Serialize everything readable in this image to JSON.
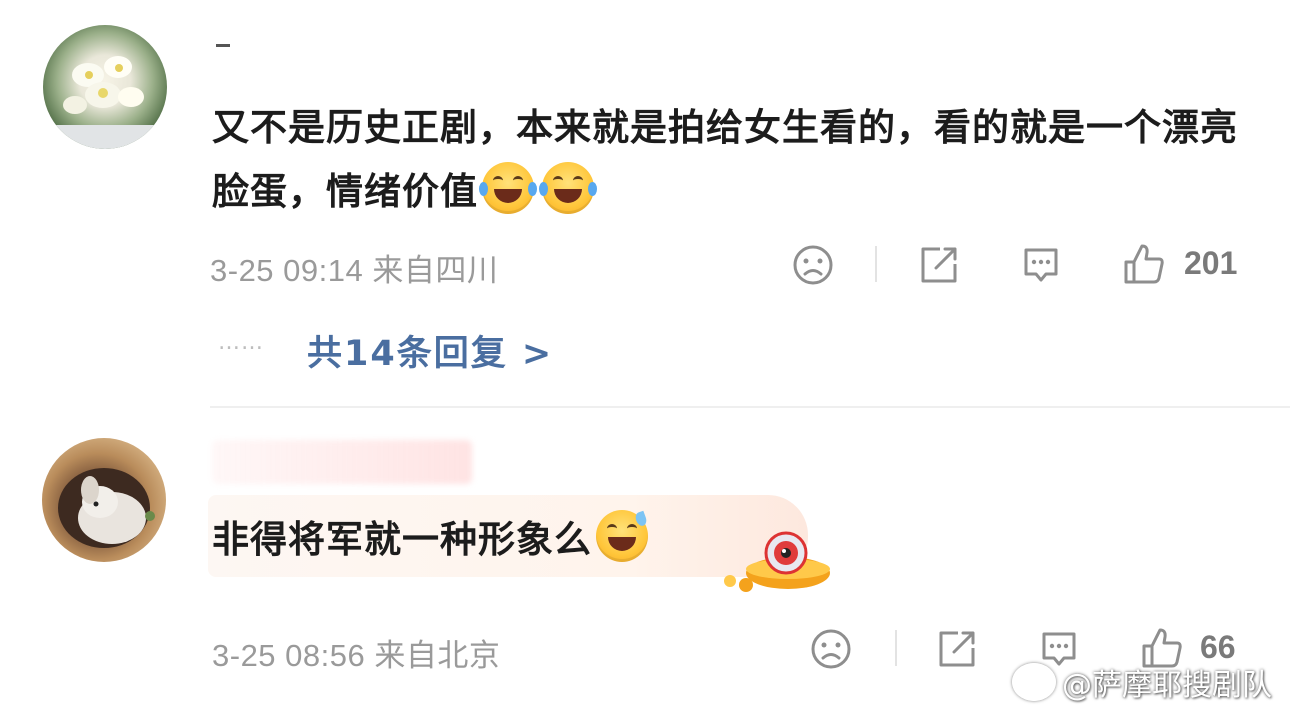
{
  "comments": [
    {
      "text_part1": "又不是历史正剧，本来就是拍给女生看的，看的就是一个漂亮脸蛋，情绪价值",
      "emojis": [
        "laugh-cry-emoji",
        "laugh-cry-emoji"
      ],
      "time": "3-25 09:14",
      "location": "来自四川",
      "likes": "201",
      "replies_dots": "……",
      "replies_link": "共14条回复 >"
    },
    {
      "text": "非得将军就一种形象么",
      "emojis": [
        "sweat-smile-emoji"
      ],
      "time": "3-25 08:56",
      "location": "来自北京",
      "likes": "66"
    }
  ],
  "watermark": "@萨摩耶搜剧队",
  "colors": {
    "link": "#4a6ea0",
    "meta": "#9a9a9a",
    "text": "#1c1c1c"
  }
}
